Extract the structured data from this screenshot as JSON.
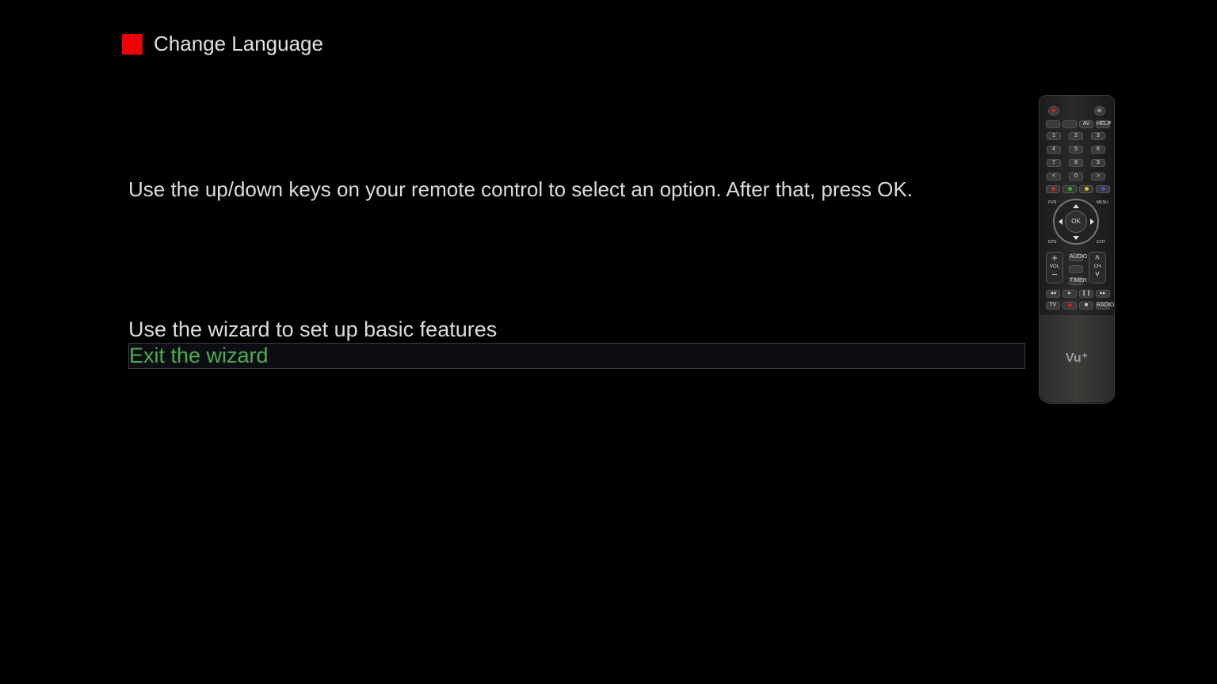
{
  "header": {
    "title": "Change Language"
  },
  "instruction": "Use the up/down keys on your remote control to select an option. After that, press OK.",
  "menu": {
    "items": [
      {
        "label": "Use the wizard to set up basic features",
        "selected": false
      },
      {
        "label": "Exit the wizard",
        "selected": true
      }
    ]
  },
  "remote": {
    "logo": "Vu⁺",
    "keys": {
      "av": "AV",
      "help": "HELP",
      "k1": "1",
      "k2": "2",
      "k3": "3",
      "k4": "4",
      "k5": "5",
      "k6": "6",
      "k7": "7",
      "k8": "8",
      "k9": "9",
      "k0": "0",
      "prev": "<",
      "next": ">",
      "pvr": "PVR",
      "menu": "MENU",
      "ok": "OK",
      "epg": "EPG",
      "exit": "EXIT",
      "vol": "VOL",
      "ch": "CH",
      "audio": "AUDIO",
      "timer": "TIMER",
      "tv": "TV",
      "radio": "RADIO"
    }
  },
  "colors": {
    "accent_red": "#ee0000",
    "selected_text": "#4caf50",
    "text": "#dcdcdc",
    "background": "#000000"
  }
}
